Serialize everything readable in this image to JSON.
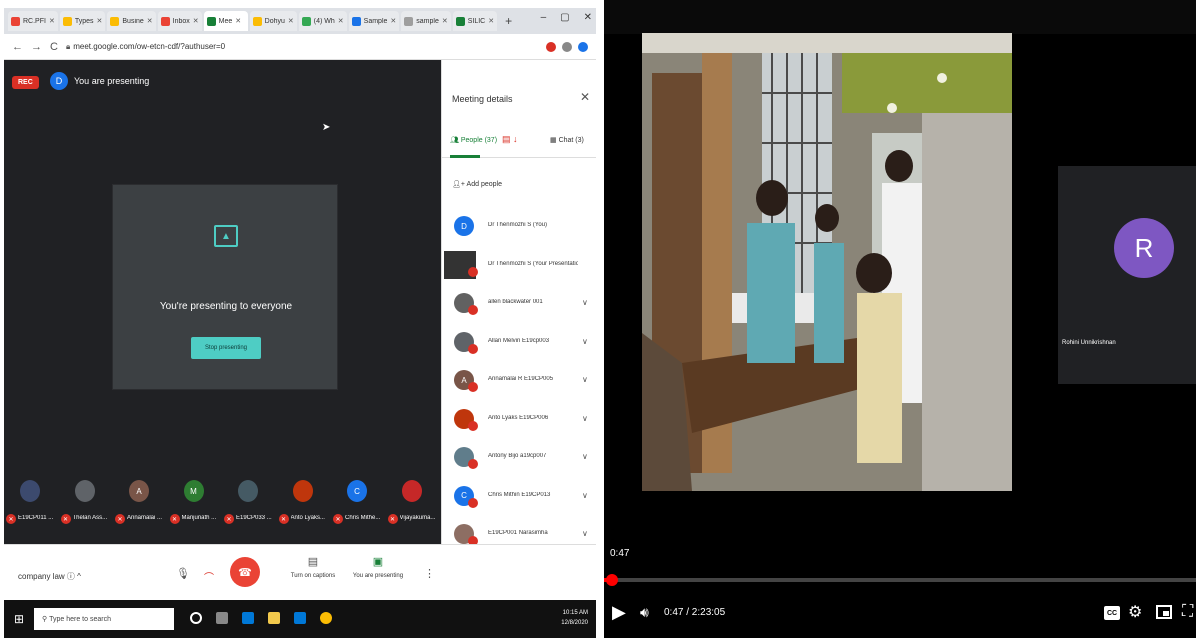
{
  "browser": {
    "tabs": [
      {
        "label": "RC.PFI",
        "color": "#ea4335"
      },
      {
        "label": "Types",
        "color": "#fbbc04"
      },
      {
        "label": "Busine",
        "color": "#fbbc04"
      },
      {
        "label": "Inbox",
        "color": "#ea4335"
      },
      {
        "label": "Mee",
        "color": "#188038",
        "active": true
      },
      {
        "label": "Dohyu",
        "color": "#fbbc04"
      },
      {
        "label": "(4) Wh",
        "color": "#34a853"
      },
      {
        "label": "Sample",
        "color": "#1a73e8"
      },
      {
        "label": "sample",
        "color": "#9e9e9e"
      },
      {
        "label": "SILIC",
        "color": "#188038"
      }
    ],
    "new_tab": "+",
    "url": "meet.google.com/ow-etcn-cdf/?authuser=0"
  },
  "meet": {
    "rec_label": "REC",
    "presenter_initial": "D",
    "presenting_text": "You are presenting",
    "card_title": "You're presenting to everyone",
    "stop_button": "Stop presenting",
    "tiles": [
      {
        "initial": "",
        "name": "E19CP011 ...",
        "color": "#3c4a6e"
      },
      {
        "initial": "",
        "name": "Thelan Ass...",
        "color": "#5f6368"
      },
      {
        "initial": "A",
        "name": "Annamalai ...",
        "color": "#795548"
      },
      {
        "initial": "M",
        "name": "Manjunath ...",
        "color": "#2e7d32"
      },
      {
        "initial": "",
        "name": "E19CP033 ...",
        "color": "#455a64"
      },
      {
        "initial": "",
        "name": "Anto Lyaks...",
        "color": "#bf360c"
      },
      {
        "initial": "C",
        "name": "Chris Mithe...",
        "color": "#1a73e8"
      },
      {
        "initial": "",
        "name": "Vijayakuma...",
        "color": "#c62828"
      }
    ],
    "meeting_name": "company law",
    "captions_label": "Turn on captions",
    "you_presenting_label": "You are presenting"
  },
  "details": {
    "title": "Meeting details",
    "people_tab": "People (37)",
    "chat_tab": "Chat (3)",
    "add_people": "Add people",
    "people": [
      {
        "initial": "D",
        "name": "Dr Thenmozhi S (You)",
        "color": "#1a73e8",
        "chevron": false
      },
      {
        "initial": "",
        "name": "Dr Thenmozhi S (Your Presentation)",
        "color": "#333333",
        "chevron": false,
        "thumb": true
      },
      {
        "initial": "",
        "name": "allen blackwater 001",
        "color": "#616161",
        "chevron": true
      },
      {
        "initial": "",
        "name": "Allan Melvin E19cp003",
        "color": "#5f6368",
        "chevron": true
      },
      {
        "initial": "A",
        "name": "Annamalai R E19CP005",
        "color": "#795548",
        "chevron": true
      },
      {
        "initial": "",
        "name": "Anto Lyaks E19CP006",
        "color": "#bf360c",
        "chevron": true
      },
      {
        "initial": "",
        "name": "Antony Bijo a19cp007",
        "color": "#607d8b",
        "chevron": true
      },
      {
        "initial": "C",
        "name": "Chris Mithin E19CP013",
        "color": "#1a73e8",
        "chevron": true
      },
      {
        "initial": "",
        "name": "E19CP001 Narasimha",
        "color": "#8d6e63",
        "chevron": true
      }
    ]
  },
  "taskbar": {
    "search_placeholder": "Type here to search",
    "time": "10:15 AM",
    "date": "12/8/2020"
  },
  "player": {
    "participant_initial": "R",
    "participant_name": "Rohini Unnikrishnan",
    "overlay_time": "0:47",
    "time_display": "0:47 / 2:23:05",
    "progress": 0.006,
    "cc_label": "CC"
  }
}
